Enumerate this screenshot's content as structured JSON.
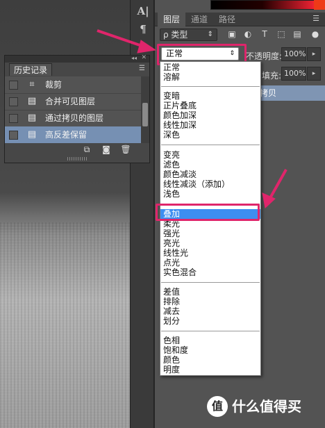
{
  "tools": {
    "type_tool": "A|",
    "paragraph_tool": "¶"
  },
  "layers_panel": {
    "tabs": [
      "图层",
      "通道",
      "路径"
    ],
    "filter": {
      "label": "ρ 类型",
      "arrow": "⇕"
    },
    "filter_icons": [
      "image-icon",
      "circle-icon",
      "text-icon",
      "shape-icon",
      "smart-object-icon"
    ],
    "blend_mode": {
      "value": "正常",
      "arrow": "⇕"
    },
    "opacity": {
      "label": "不透明度:",
      "value": "100%"
    },
    "fill": {
      "label": "填充:",
      "value": "100%"
    },
    "active_layer": "拷贝"
  },
  "blend_menu": {
    "groups": [
      [
        "正常",
        "溶解"
      ],
      [
        "变暗",
        "正片叠底",
        "颜色加深",
        "线性加深",
        "深色"
      ],
      [
        "变亮",
        "滤色",
        "颜色减淡",
        "线性减淡（添加）",
        "浅色"
      ],
      [
        "叠加",
        "柔光",
        "强光",
        "亮光",
        "线性光",
        "点光",
        "实色混合"
      ],
      [
        "差值",
        "排除",
        "减去",
        "划分"
      ],
      [
        "色相",
        "饱和度",
        "颜色",
        "明度"
      ]
    ],
    "selected": "叠加"
  },
  "history_panel": {
    "title": "历史记录",
    "items": [
      {
        "label": "裁剪",
        "icon": "crop-icon"
      },
      {
        "label": "合并可见图层",
        "icon": "document-icon"
      },
      {
        "label": "通过拷贝的图层",
        "icon": "document-icon"
      },
      {
        "label": "高反差保留",
        "icon": "document-icon",
        "selected": true
      }
    ]
  },
  "watermark": {
    "badge": "值",
    "text": "什么值得买"
  },
  "colors": {
    "highlight": "#e0256b",
    "selection": "#3d8ef0",
    "panel": "#535353",
    "history_selected": "#7690b3"
  }
}
